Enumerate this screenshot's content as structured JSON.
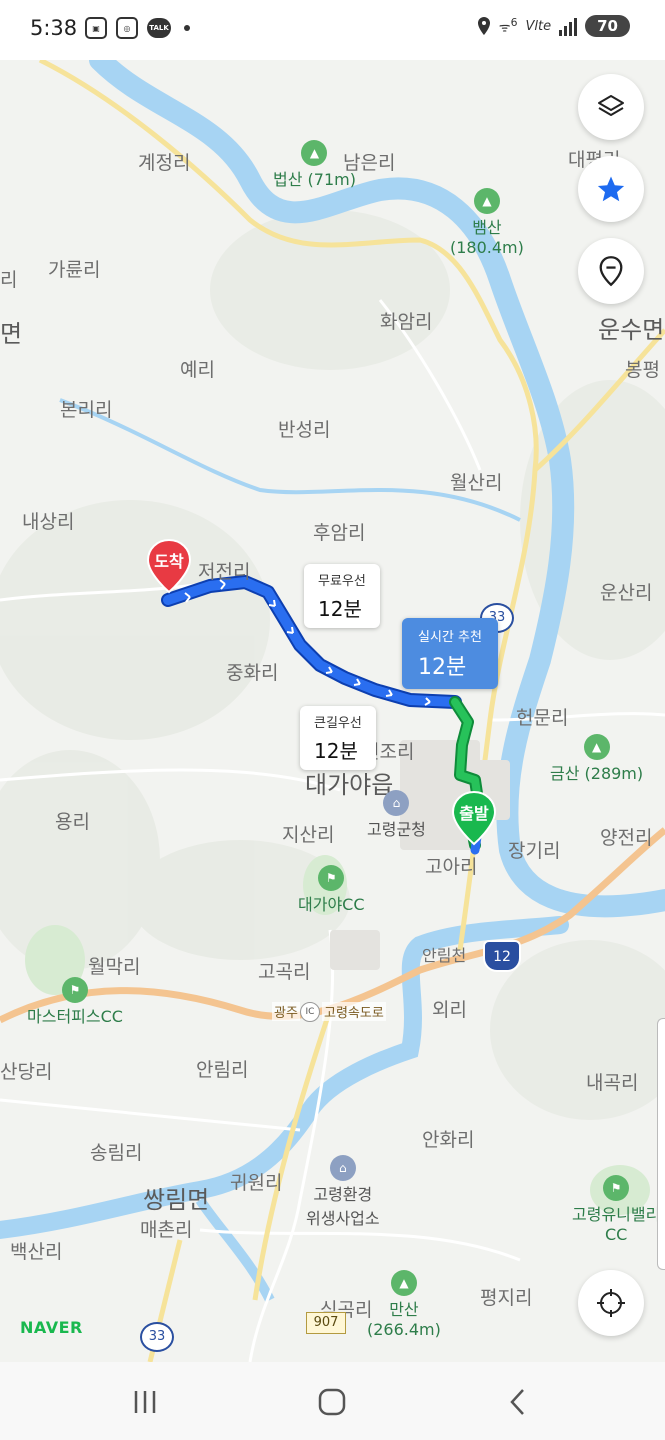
{
  "status_bar": {
    "time": "5:38",
    "battery": "70",
    "network": "Vlte",
    "wifi_badge": "6",
    "talk_label": "TALK"
  },
  "places": [
    {
      "name": "계정리"
    },
    {
      "name": "남은리"
    },
    {
      "name": "가륜리"
    },
    {
      "name": "화암리"
    },
    {
      "name": "예리"
    },
    {
      "name": "본리리"
    },
    {
      "name": "반성리"
    },
    {
      "name": "월산리"
    },
    {
      "name": "내상리"
    },
    {
      "name": "후암리"
    },
    {
      "name": "저전리"
    },
    {
      "name": "중화리"
    },
    {
      "name": "운산리"
    },
    {
      "name": "헌문리"
    },
    {
      "name": "연조리"
    },
    {
      "name": "용리"
    },
    {
      "name": "지산리"
    },
    {
      "name": "장기리"
    },
    {
      "name": "고아리"
    },
    {
      "name": "양전리"
    },
    {
      "name": "월막리"
    },
    {
      "name": "고곡리"
    },
    {
      "name": "외리"
    },
    {
      "name": "산당리"
    },
    {
      "name": "안림리"
    },
    {
      "name": "내곡리"
    },
    {
      "name": "송림리"
    },
    {
      "name": "귀원리"
    },
    {
      "name": "안화리"
    },
    {
      "name": "매촌리"
    },
    {
      "name": "백산리"
    },
    {
      "name": "평지리"
    },
    {
      "name": "쌍림면"
    },
    {
      "name": "대가야읍"
    },
    {
      "name": "운수면"
    },
    {
      "name": "봉평"
    },
    {
      "name": "대평리"
    },
    {
      "name": "안림천"
    },
    {
      "name": "식곡리"
    },
    {
      "name": "면"
    },
    {
      "name": "리"
    }
  ],
  "pois": [
    {
      "name": "법산 (71m)"
    },
    {
      "name": "뱀산"
    },
    {
      "name": "(180.4m)"
    },
    {
      "name": "금산 (289m)"
    },
    {
      "name": "고령군청"
    },
    {
      "name": "대가야CC"
    },
    {
      "name": "마스터피스CC"
    },
    {
      "name": "고령환경"
    },
    {
      "name": "위생사업소"
    },
    {
      "name": "만산"
    },
    {
      "name": "(266.4m)"
    },
    {
      "name": "고령유니밸리"
    },
    {
      "name": "CC"
    }
  ],
  "roads": {
    "expressway": "광주",
    "expressway2": "고령속도로",
    "ic": "IC",
    "route_12": "12",
    "route_33": "33",
    "route_907": "907",
    "route_33_top": "33"
  },
  "routes": [
    {
      "name": "무료우선",
      "duration": "12분"
    },
    {
      "name": "실시간 추천",
      "duration": "12분"
    },
    {
      "name": "큰길우선",
      "duration": "12분"
    }
  ],
  "markers": {
    "destination": "도착",
    "origin": "출발"
  },
  "map_controls": {
    "layers": "layers-icon",
    "favorite": "star-icon",
    "location_pin": "pin-icon",
    "current_location": "crosshair-icon"
  },
  "brand": "NAVER",
  "colors": {
    "route_blue": "#1e5fe0",
    "route_green": "#19b84e",
    "river": "#a7d4f3",
    "expressway": "#f4c490"
  }
}
